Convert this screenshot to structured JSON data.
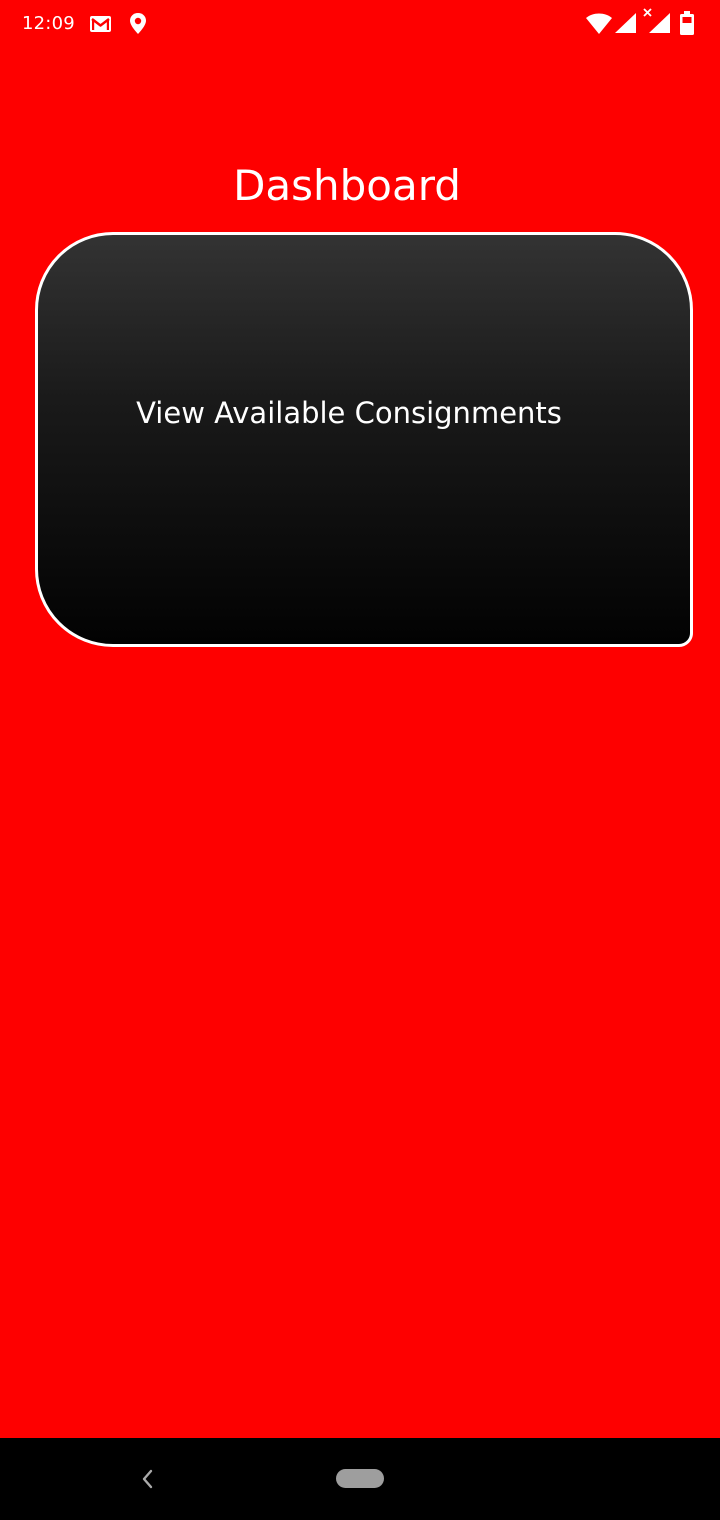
{
  "status_bar": {
    "time": "12:09",
    "icons": [
      "gmail-icon",
      "location-icon",
      "wifi-icon",
      "signal-icon",
      "signal-no-data-icon",
      "battery-icon"
    ]
  },
  "page": {
    "title": "Dashboard",
    "background_color": "#fe0000"
  },
  "card": {
    "label": "View Available Consignments"
  },
  "nav_bar": {
    "icons": [
      "back-icon",
      "home-pill"
    ]
  }
}
